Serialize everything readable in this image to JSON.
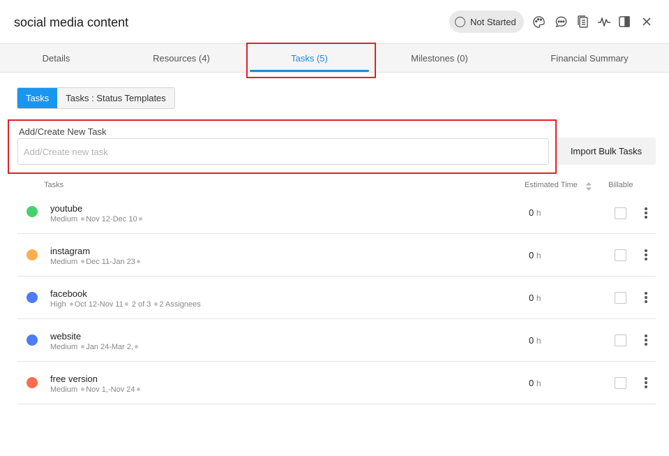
{
  "header": {
    "title": "social media content",
    "status_label": "Not Started"
  },
  "icons": {
    "status": "circle-icon",
    "palette": "palette-icon",
    "comments": "chat-bubble-icon",
    "documents": "documents-icon",
    "activity": "activity-pulse-icon",
    "panel": "sidebar-panel-icon",
    "close": "close-icon",
    "sort": "sort-arrows-icon",
    "more": "more-vertical-icon"
  },
  "tabs": [
    {
      "label": "Details"
    },
    {
      "label": "Resources (4)"
    },
    {
      "label": "Tasks (5)"
    },
    {
      "label": "Milestones (0)"
    },
    {
      "label": "Financial Summary"
    }
  ],
  "active_tab": "Tasks (5)",
  "subtabs": [
    {
      "label": "Tasks"
    },
    {
      "label": "Tasks : Status Templates"
    }
  ],
  "new_task": {
    "label": "Add/Create New Task",
    "placeholder": "Add/Create new task",
    "value": "",
    "import_button": "Import Bulk Tasks"
  },
  "table": {
    "headers": {
      "tasks": "Tasks",
      "estimated_time": "Estimated Time",
      "billable": "Billable"
    },
    "rows": [
      {
        "name": "youtube",
        "priority": "Medium",
        "dates": "Nov 12-Dec 10",
        "extra": "",
        "estimate": "0",
        "unit": "h",
        "billable": false,
        "color": "#45d16e"
      },
      {
        "name": "instagram",
        "priority": "Medium",
        "dates": "Dec 11-Jan 23",
        "extra": "",
        "estimate": "0",
        "unit": "h",
        "billable": false,
        "color": "#ffae4b"
      },
      {
        "name": "facebook",
        "priority": "High",
        "dates": "Oct 12-Nov 11",
        "extra": "2 of 3",
        "assignees": "2 Assignees",
        "estimate": "0",
        "unit": "h",
        "billable": false,
        "color": "#4d7cf5"
      },
      {
        "name": "website",
        "priority": "Medium",
        "dates": "Jan 24-Mar 2,",
        "extra": "",
        "estimate": "0",
        "unit": "h",
        "billable": false,
        "color": "#4d7cf5"
      },
      {
        "name": "free version",
        "priority": "Medium",
        "dates": "Nov 1,-Nov 24",
        "extra": "",
        "estimate": "0",
        "unit": "h",
        "billable": false,
        "color": "#ff6c4f"
      }
    ]
  },
  "colors": {
    "accent": "#1a8cd8",
    "segment_active": "#1a96f0",
    "highlight_box": "#e0202a"
  }
}
